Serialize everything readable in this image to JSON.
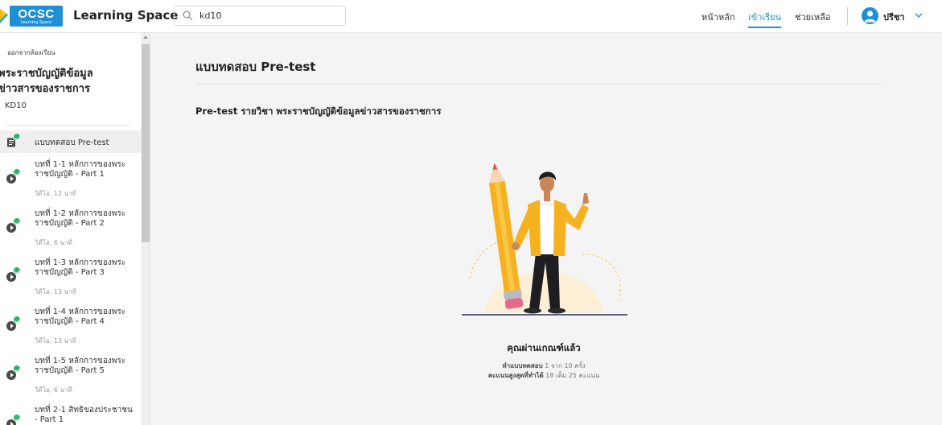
{
  "header": {
    "logo_text": "OCSC",
    "logo_sub": "Learning Space",
    "app_title": "Learning Space",
    "search_value": "kd10",
    "nav": [
      {
        "label": "หน้าหลัก",
        "active": false
      },
      {
        "label": "เข้าเรียน",
        "active": true
      },
      {
        "label": "ช่วยเหลือ",
        "active": false
      }
    ],
    "user_name": "ปรีชา"
  },
  "sidebar": {
    "back_label": "ออกจากห้องเรียน",
    "course_title_line1": "พระราชบัญญัติข้อมูล",
    "course_title_line2": "ข่าวสารของราชการ",
    "course_code": "KD10",
    "items": [
      {
        "label": "แบบทดสอบ Pre-test",
        "sub": "",
        "type": "quiz",
        "completed": true,
        "active": true
      },
      {
        "label": "บทที่ 1-1 หลักการของพระราชบัญญัติ - Part 1",
        "sub": "วิดีโอ, 12 นาที",
        "type": "video",
        "completed": true,
        "active": false
      },
      {
        "label": "บทที่ 1-2 หลักการของพระราชบัญญัติ - Part 2",
        "sub": "วิดีโอ, 6 นาที",
        "type": "video",
        "completed": true,
        "active": false
      },
      {
        "label": "บทที่ 1-3 หลักการของพระราชบัญญัติ - Part 3",
        "sub": "วิดีโอ, 13 นาที",
        "type": "video",
        "completed": true,
        "active": false
      },
      {
        "label": "บทที่ 1-4 หลักการของพระราชบัญญัติ - Part 4",
        "sub": "วิดีโอ, 13 นาที",
        "type": "video",
        "completed": true,
        "active": false
      },
      {
        "label": "บทที่ 1-5 หลักการของพระราชบัญญัติ - Part 5",
        "sub": "วิดีโอ, 6 นาที",
        "type": "video",
        "completed": true,
        "active": false
      },
      {
        "label": "บทที่ 2-1 สิทธิของประชาชน - Part 1",
        "sub": "",
        "type": "video",
        "completed": true,
        "active": false
      }
    ]
  },
  "main": {
    "page_title": "แบบทดสอบ Pre-test",
    "subtitle": "Pre-test รายวิชา พระราชบัญญัติข้อมูลข่าวสารของราชการ",
    "result_title": "คุณผ่านเกณฑ์แล้ว",
    "attempts_label": "ทำแบบทดสอบ",
    "attempts_value": "1 จาก 10 ครั้ง",
    "score_label": "คะแนนสูงสุดที่ทำได้",
    "score_value": "18 เต็ม 25 คะแนน"
  },
  "colors": {
    "accent": "#1f8fd6",
    "check": "#2eb36b",
    "jacket": "#f5b21e"
  }
}
